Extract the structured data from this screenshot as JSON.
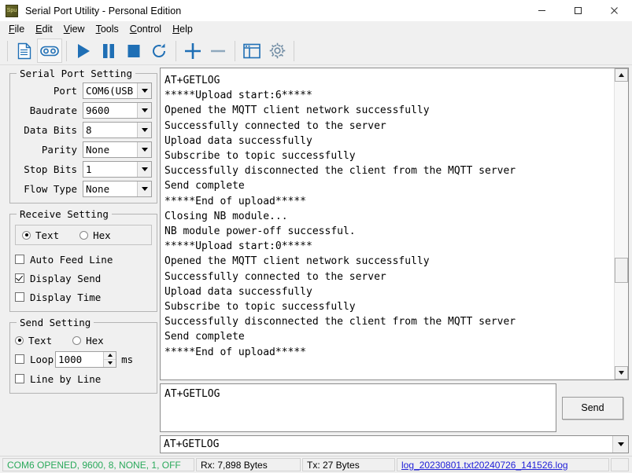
{
  "window": {
    "title": "Serial Port Utility - Personal Edition",
    "icon": "app-icon",
    "minimize_label": "─",
    "maximize_label": "□",
    "close_label": "✕"
  },
  "menubar": {
    "items": [
      {
        "label": "File",
        "mnemonic": "F"
      },
      {
        "label": "Edit",
        "mnemonic": "E"
      },
      {
        "label": "View",
        "mnemonic": "V"
      },
      {
        "label": "Tools",
        "mnemonic": "T"
      },
      {
        "label": "Control",
        "mnemonic": "C"
      },
      {
        "label": "Help",
        "mnemonic": "H"
      }
    ]
  },
  "toolbar": {
    "buttons": [
      {
        "name": "new-document-icon",
        "title": "New"
      },
      {
        "name": "record-icon",
        "title": "Record"
      },
      {
        "name": "play-icon",
        "title": "Open Port"
      },
      {
        "name": "pause-icon",
        "title": "Pause"
      },
      {
        "name": "stop-icon",
        "title": "Stop"
      },
      {
        "name": "refresh-icon",
        "title": "Refresh"
      },
      {
        "name": "plus-icon",
        "title": "Add"
      },
      {
        "name": "minus-icon",
        "title": "Remove"
      },
      {
        "name": "layout-icon",
        "title": "Layout"
      },
      {
        "name": "gear-icon",
        "title": "Settings"
      }
    ]
  },
  "serial_port_setting": {
    "legend": "Serial Port Setting",
    "fields": [
      {
        "label": "Port",
        "value": "COM6(USB",
        "name": "port-select"
      },
      {
        "label": "Baudrate",
        "value": "9600",
        "name": "baudrate-select"
      },
      {
        "label": "Data Bits",
        "value": "8",
        "name": "data-bits-select"
      },
      {
        "label": "Parity",
        "value": "None",
        "name": "parity-select"
      },
      {
        "label": "Stop Bits",
        "value": "1",
        "name": "stop-bits-select"
      },
      {
        "label": "Flow Type",
        "value": "None",
        "name": "flow-type-select"
      }
    ]
  },
  "receive_setting": {
    "legend": "Receive Setting",
    "mode_text": "Text",
    "mode_hex": "Hex",
    "mode_selected": "Text",
    "checkboxes": [
      {
        "label": "Auto Feed Line",
        "checked": false,
        "name": "auto-feed-line-checkbox"
      },
      {
        "label": "Display Send",
        "checked": true,
        "name": "display-send-checkbox"
      },
      {
        "label": "Display Time",
        "checked": false,
        "name": "display-time-checkbox"
      }
    ]
  },
  "send_setting": {
    "legend": "Send Setting",
    "mode_text": "Text",
    "mode_hex": "Hex",
    "mode_selected": "Text",
    "loop_label": "Loop",
    "loop_checked": false,
    "loop_value": "1000",
    "loop_unit": "ms",
    "line_by_line_label": "Line by Line",
    "line_by_line_checked": false
  },
  "log_view": {
    "name": "receive-log",
    "content": "AT+GETLOG\n*****Upload start:6*****\nOpened the MQTT client network successfully\nSuccessfully connected to the server\nUpload data successfully\nSubscribe to topic successfully\nSuccessfully disconnected the client from the MQTT server\nSend complete\n*****End of upload*****\nClosing NB module...\nNB module power-off successful.\n*****Upload start:0*****\nOpened the MQTT client network successfully\nSuccessfully connected to the server\nUpload data successfully\nSubscribe to topic successfully\nSuccessfully disconnected the client from the MQTT server\nSend complete\n*****End of upload*****"
  },
  "send_area": {
    "textarea_value": "AT+GETLOG",
    "send_button_label": "Send",
    "history_value": "AT+GETLOG"
  },
  "statusbar": {
    "connection": "COM6 OPENED, 9600, 8, NONE, 1, OFF",
    "rx": "Rx: 7,898 Bytes",
    "tx": "Tx: 27 Bytes",
    "log_file": "log_20230801.txt20240726_141526.log",
    "spare": ""
  },
  "colors": {
    "accent": "#1f6fb5",
    "status_ok": "#2aa95b",
    "link": "#2020d8",
    "window_bg": "#f0f0f0"
  }
}
